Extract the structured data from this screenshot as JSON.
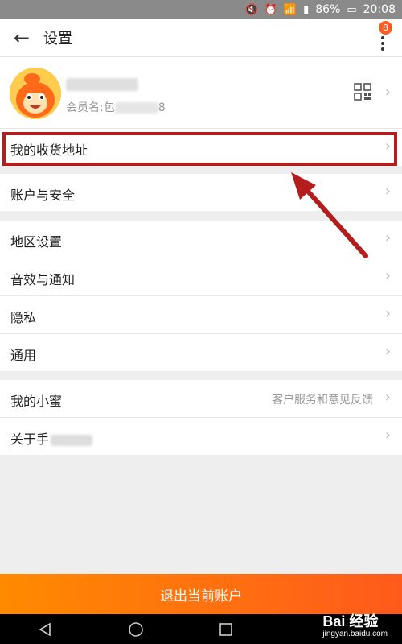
{
  "status_bar": {
    "battery": "86%",
    "time": "20:08"
  },
  "header": {
    "back_icon": "arrow-left-icon",
    "title": "设置",
    "more_icon": "more-vertical-icon",
    "notification_count": "8"
  },
  "profile": {
    "avatar_icon": "mascot-avatar",
    "member_prefix": "会员名:包",
    "member_suffix": "8",
    "qr_icon": "qr-code-icon"
  },
  "sections": [
    {
      "items": [
        {
          "label": "我的收货地址",
          "value": ""
        }
      ]
    },
    {
      "items": [
        {
          "label": "账户与安全",
          "value": ""
        }
      ]
    },
    {
      "items": [
        {
          "label": "地区设置",
          "value": ""
        },
        {
          "label": "音效与通知",
          "value": ""
        },
        {
          "label": "隐私",
          "value": ""
        },
        {
          "label": "通用",
          "value": ""
        }
      ]
    },
    {
      "items": [
        {
          "label": "我的小蜜",
          "value": "客户服务和意见反馈"
        },
        {
          "label": "关于手",
          "value": ""
        }
      ]
    }
  ],
  "logout": {
    "label": "退出当前账户"
  },
  "watermark": {
    "text": "Bai 经验",
    "sub": "jingyan.baidu.com"
  },
  "colors": {
    "accent": "#ff6a00",
    "highlight": "#b51d1d",
    "badge": "#ff5b22"
  }
}
